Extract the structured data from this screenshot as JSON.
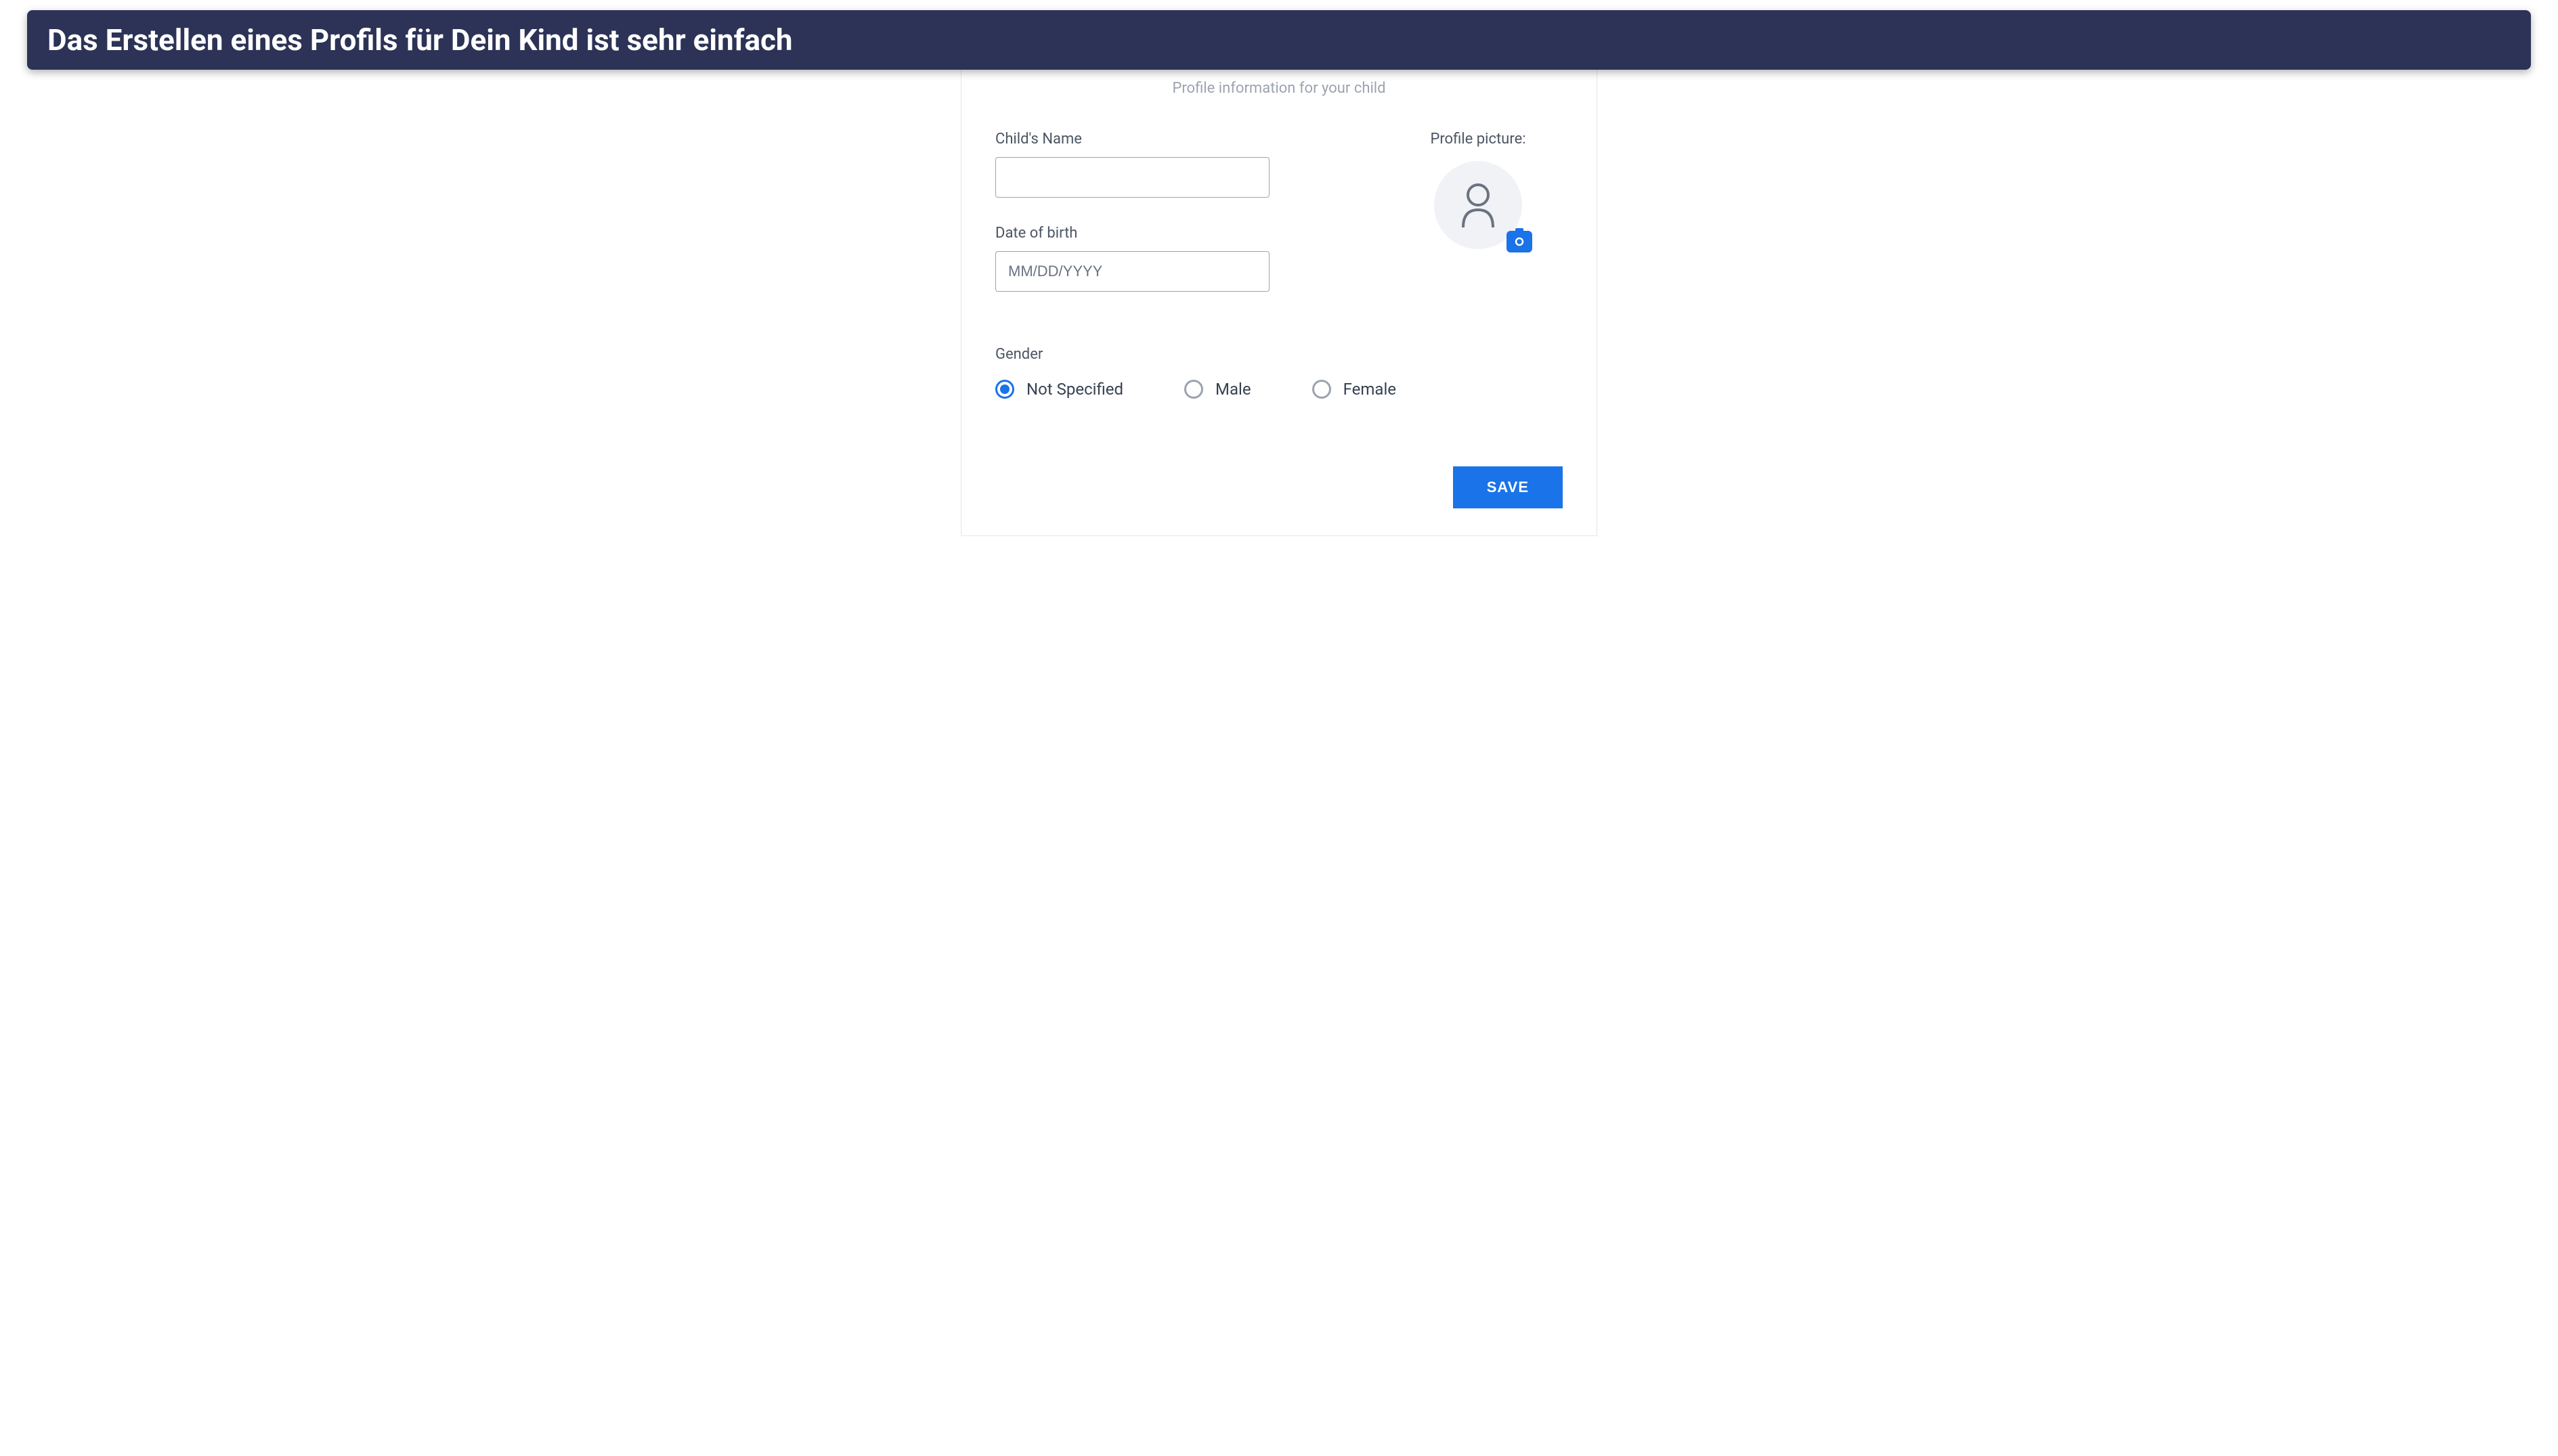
{
  "banner": {
    "title": "Das Erstellen eines Profils für Dein Kind ist sehr einfach"
  },
  "form": {
    "subtitle": "Profile information for your child",
    "childName": {
      "label": "Child's Name",
      "value": ""
    },
    "dateOfBirth": {
      "label": "Date of birth",
      "placeholder": "MM/DD/YYYY",
      "value": ""
    },
    "profilePicture": {
      "label": "Profile picture:"
    },
    "gender": {
      "label": "Gender",
      "selected": "not_specified",
      "options": [
        {
          "value": "not_specified",
          "label": "Not Specified"
        },
        {
          "value": "male",
          "label": "Male"
        },
        {
          "value": "female",
          "label": "Female"
        }
      ]
    },
    "saveButton": "SAVE"
  },
  "colors": {
    "primary": "#1a73e8",
    "bannerBg": "#2c3356"
  }
}
